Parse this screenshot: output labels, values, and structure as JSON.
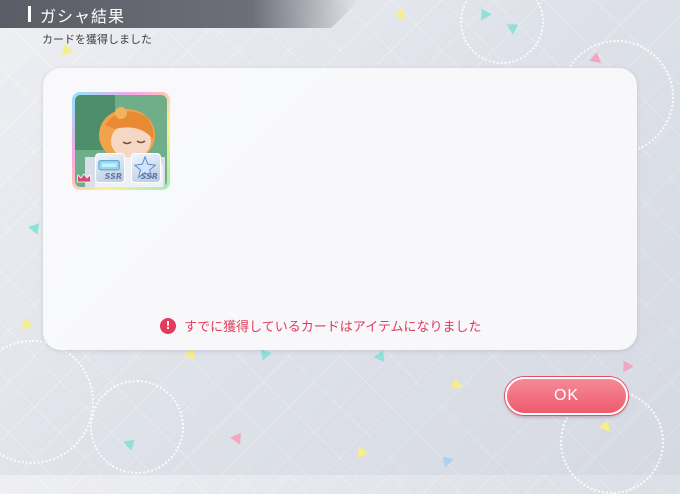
{
  "header": {
    "title": "ガシャ結果",
    "subtitle": "カードを獲得しました"
  },
  "result_panel": {
    "cards": [
      {
        "rarity": "SSR",
        "badges": [
          {
            "label": "SSR",
            "icon": "ticket-icon"
          },
          {
            "label": "SSR",
            "icon": "star-piece-icon"
          }
        ]
      }
    ],
    "notice": "すでに獲得しているカードはアイテムになりました",
    "notice_icon": "!"
  },
  "ok_button": {
    "label": "OK"
  },
  "colors": {
    "accent_pink": "#ee5a6e",
    "notice_red": "#e23b5b",
    "title_bar": "#5a5d66"
  }
}
